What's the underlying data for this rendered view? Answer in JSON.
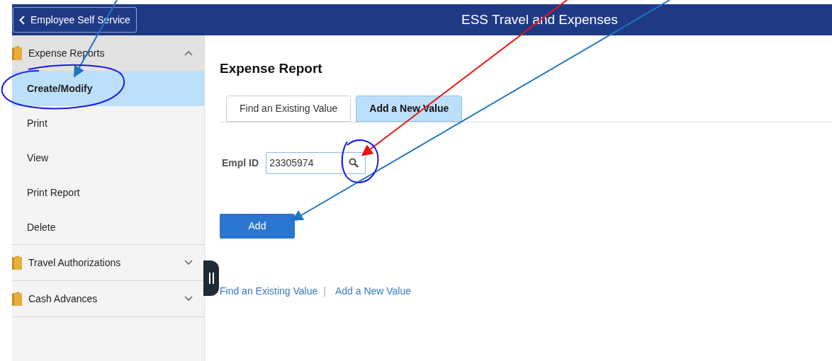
{
  "header": {
    "back_button": "Employee Self Service",
    "title": "ESS Travel and Expenses"
  },
  "sidebar": {
    "groups": [
      {
        "label": "Expense Reports",
        "expanded": true,
        "items": [
          {
            "label": "Create/Modify",
            "selected": true
          },
          {
            "label": "Print",
            "selected": false
          },
          {
            "label": "View",
            "selected": false
          },
          {
            "label": "Print Report",
            "selected": false
          },
          {
            "label": "Delete",
            "selected": false
          }
        ]
      },
      {
        "label": "Travel Authorizations",
        "expanded": false
      },
      {
        "label": "Cash Advances",
        "expanded": false
      }
    ]
  },
  "main": {
    "title": "Expense Report",
    "tabs": [
      {
        "label": "Find an Existing Value",
        "selected": false
      },
      {
        "label": "Add a New Value",
        "selected": true
      }
    ],
    "field": {
      "label": "Empl ID",
      "value": "23305974"
    },
    "add_button": "Add",
    "links": [
      "Find an Existing Value",
      "Add a New Value"
    ],
    "link_separator": "|"
  }
}
